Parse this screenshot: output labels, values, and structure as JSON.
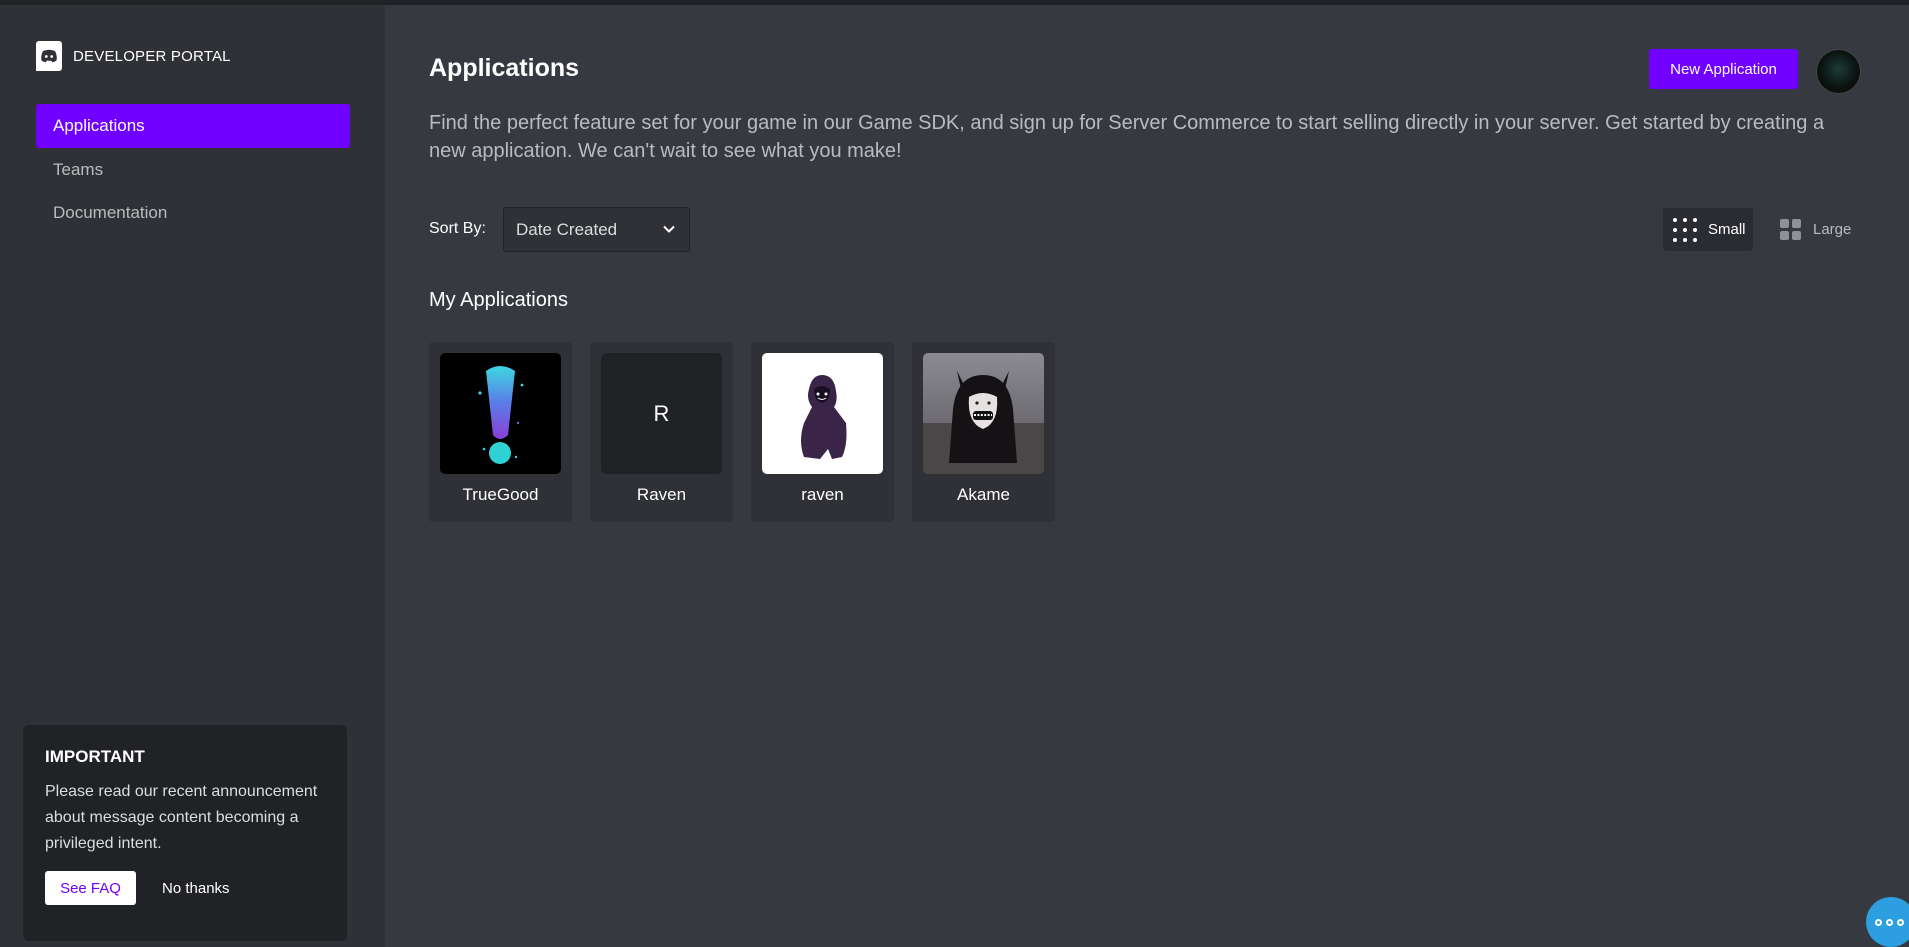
{
  "brand": {
    "label": "DEVELOPER PORTAL",
    "icon": "discord-logo-icon"
  },
  "sidebar": {
    "items": [
      {
        "label": "Applications",
        "active": true
      },
      {
        "label": "Teams",
        "active": false
      },
      {
        "label": "Documentation",
        "active": false
      }
    ]
  },
  "notice": {
    "title": "IMPORTANT",
    "body": "Please read our recent announcement about message content becoming a privileged intent.",
    "faq_label": "See FAQ",
    "dismiss_label": "No thanks"
  },
  "header": {
    "title": "Applications",
    "new_app_label": "New Application",
    "description": "Find the perfect feature set for your game in our Game SDK, and sign up for Server Commerce to start selling directly in your server. Get started by creating a new application. We can't wait to see what you make!"
  },
  "sort": {
    "label": "Sort By:",
    "selected": "Date Created"
  },
  "view": {
    "small_label": "Small",
    "large_label": "Large",
    "selected": "Small"
  },
  "apps_section": {
    "title": "My Applications",
    "apps": [
      {
        "name": "TrueGood",
        "icon": "exclamation-splash-icon"
      },
      {
        "name": "Raven",
        "icon": "letter-avatar-icon",
        "letter": "R"
      },
      {
        "name": "raven",
        "icon": "hooded-figure-icon"
      },
      {
        "name": "Akame",
        "icon": "horned-character-icon"
      }
    ]
  },
  "colors": {
    "accent": "#7000ff",
    "background": "#36393f",
    "sidebar": "#2f3136",
    "notice": "#202225",
    "chat": "#2d9ee0"
  }
}
